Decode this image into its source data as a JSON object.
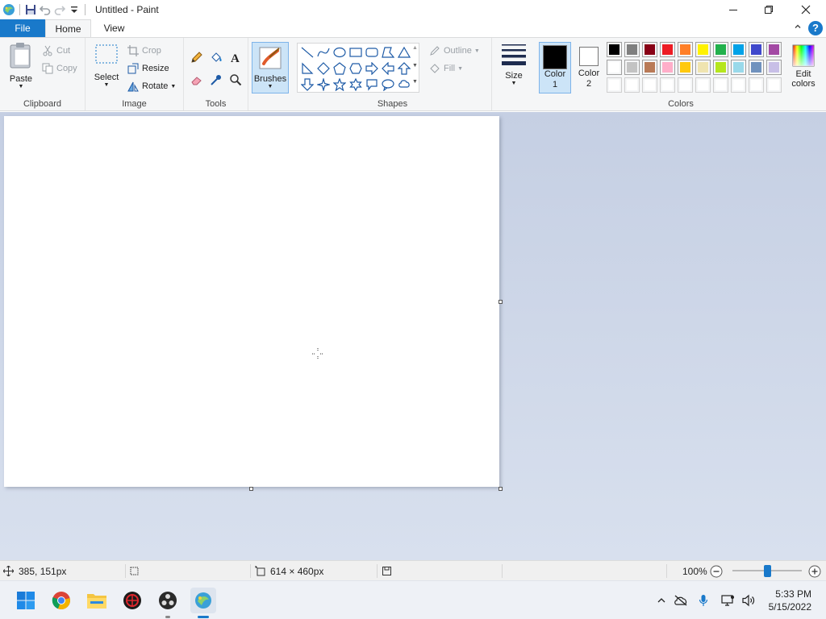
{
  "window": {
    "title": "Untitled - Paint"
  },
  "tabs": [
    {
      "label": "File"
    },
    {
      "label": "Home"
    },
    {
      "label": "View"
    }
  ],
  "ribbon": {
    "clipboard": {
      "label": "Clipboard",
      "paste": "Paste",
      "cut": "Cut",
      "copy": "Copy"
    },
    "image": {
      "label": "Image",
      "select": "Select",
      "crop": "Crop",
      "resize": "Resize",
      "rotate": "Rotate"
    },
    "tools": {
      "label": "Tools"
    },
    "brushes": {
      "label": "Brushes"
    },
    "shapes": {
      "label": "Shapes",
      "outline": "Outline",
      "fill": "Fill"
    },
    "size": {
      "label": "Size"
    },
    "colors": {
      "label": "Colors",
      "color1": "Color\n1",
      "color1_l1": "Color",
      "color1_l2": "1",
      "color2_l1": "Color",
      "color2_l2": "2",
      "edit_l1": "Edit",
      "edit_l2": "colors",
      "color1_value": "#000000",
      "color2_value": "#ffffff",
      "palette_row1": [
        "#000000",
        "#7f7f7f",
        "#880015",
        "#ed1c24",
        "#ff7f27",
        "#fff200",
        "#22b14c",
        "#00a2e8",
        "#3f48cc",
        "#a349a4"
      ],
      "palette_row2": [
        "#ffffff",
        "#c3c3c3",
        "#b97a57",
        "#ffaec9",
        "#ffc90e",
        "#efe4b0",
        "#b5e61d",
        "#99d9ea",
        "#7092be",
        "#c8bfe7"
      ],
      "palette_row3": [
        "#ffffff",
        "#ffffff",
        "#ffffff",
        "#ffffff",
        "#ffffff",
        "#ffffff",
        "#ffffff",
        "#ffffff",
        "#ffffff",
        "#ffffff"
      ]
    }
  },
  "status": {
    "cursor_pos": "385, 151px",
    "canvas_size": "614 × 460px",
    "zoom": "100%",
    "zoom_level_fraction": 0.5
  },
  "taskbar": {
    "time": "5:33 PM",
    "date": "5/15/2022"
  }
}
